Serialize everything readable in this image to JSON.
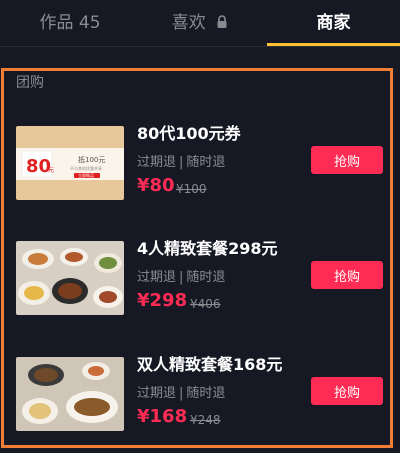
{
  "tabs": {
    "works": "作品 45",
    "likes": "喜欢",
    "merchant": "商家"
  },
  "colors": {
    "accent": "#fe2c55",
    "underline": "#fbc132",
    "highlight_border": "#f27d36",
    "background": "#161823"
  },
  "section": {
    "title": "团购"
  },
  "deals": [
    {
      "title": "80代100元券",
      "tag1": "过期退",
      "tag2": "随时退",
      "price": "¥80",
      "original_price": "¥100",
      "buy_label": "抢购",
      "voucher": {
        "big": "80",
        "small": "元",
        "line1": "抵100元",
        "line2": "不与其他优惠共享",
        "stamp": "立即购买"
      }
    },
    {
      "title": "4人精致套餐298元",
      "tag1": "过期退",
      "tag2": "随时退",
      "price": "¥298",
      "original_price": "¥406",
      "buy_label": "抢购"
    },
    {
      "title": "双人精致套餐168元",
      "tag1": "过期退",
      "tag2": "随时退",
      "price": "¥168",
      "original_price": "¥248",
      "buy_label": "抢购"
    }
  ],
  "separator": "|"
}
